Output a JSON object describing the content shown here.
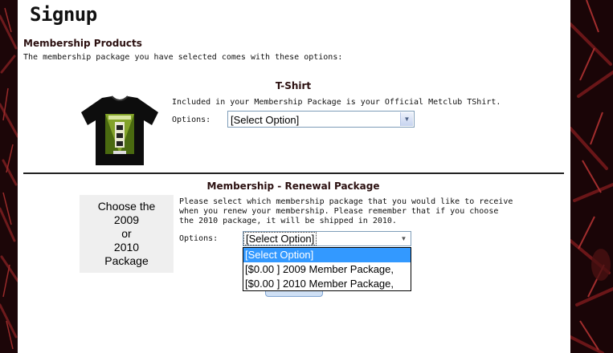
{
  "page": {
    "title": "Signup"
  },
  "membership_products": {
    "heading": "Membership Products",
    "intro": "The membership package you have selected comes with these options:"
  },
  "tshirt": {
    "title": "T-Shirt",
    "description": "Included in your Membership Package is your Official Metclub TShirt.",
    "options_label": "Options:",
    "select_value": "[Select Option]"
  },
  "renewal": {
    "title": "Membership - Renewal Package",
    "choose_text": [
      "Choose the",
      "2009",
      "or",
      "2010",
      "Package"
    ],
    "description_lines": [
      "Please select which membership package that you would like to receive",
      "when you renew your membership. Please remember that if you choose",
      "the 2010 package, it will be shipped in 2010."
    ],
    "options_label": "Options:",
    "select_value": "[Select Option]",
    "dropdown_options": [
      {
        "label": "[Select Option]",
        "selected": true
      },
      {
        "label": "[$0.00 ] 2009 Member Package,",
        "selected": false
      },
      {
        "label": "[$0.00 ] 2010 Member Package,",
        "selected": false
      }
    ]
  },
  "icons": {
    "dropdown_arrow": "chevron-down-icon"
  },
  "colors": {
    "dropdown_highlight": "#3399ff",
    "select_border": "#7f9db9",
    "side_background": "#1a0708",
    "heading_color": "#2b1010"
  }
}
